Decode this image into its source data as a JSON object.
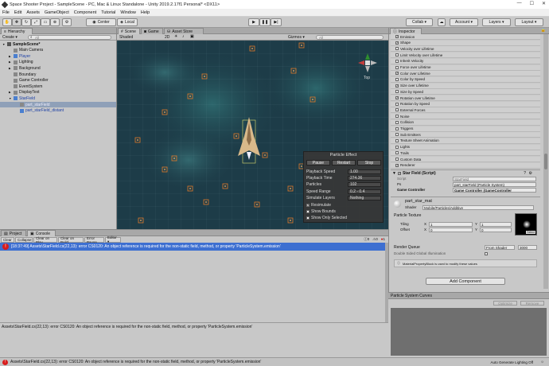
{
  "window": {
    "title": "Space Shooter Project - SampleScene - PC, Mac & Linux Standalone - Unity 2019.2.17f1 Personal* <DX11>",
    "minimize": "—",
    "maximize": "☐",
    "close": "✕"
  },
  "menu": [
    "File",
    "Edit",
    "Assets",
    "GameObject",
    "Component",
    "Tutorial",
    "Window",
    "Help"
  ],
  "toolbar": {
    "pivot_center": "Center",
    "pivot_local": "Local",
    "collab": "Collab ▾",
    "account": "Account ▾",
    "layers": "Layers ▾",
    "layout": "Layout ▾"
  },
  "hierarchy": {
    "tab": "Hierarchy",
    "create": "Create ▾",
    "search_placeholder": "All",
    "items": [
      {
        "label": "SampleScene*",
        "indent": 0,
        "icon": "scene-icon",
        "arrow": "▼",
        "bold": true
      },
      {
        "label": "Main Camera",
        "indent": 1,
        "icon": "cube-icon",
        "arrow": "",
        "bold": false
      },
      {
        "label": "Player",
        "indent": 1,
        "icon": "cube-icon",
        "arrow": "▶",
        "bold": false,
        "blue": true
      },
      {
        "label": "Lighting",
        "indent": 1,
        "icon": "cube-icon",
        "arrow": "▶",
        "bold": false
      },
      {
        "label": "Background",
        "indent": 1,
        "icon": "cube-icon",
        "arrow": "▶",
        "bold": false
      },
      {
        "label": "Boundary",
        "indent": 1,
        "icon": "cube-icon",
        "arrow": "",
        "bold": false
      },
      {
        "label": "Game Controller",
        "indent": 1,
        "icon": "cube-icon",
        "arrow": "",
        "bold": false
      },
      {
        "label": "EventSystem",
        "indent": 1,
        "icon": "cube-icon",
        "arrow": "",
        "bold": false
      },
      {
        "label": "DisplayText",
        "indent": 1,
        "icon": "cube-icon",
        "arrow": "▶",
        "bold": false
      },
      {
        "label": "StarField",
        "indent": 1,
        "icon": "cube-icon",
        "arrow": "▼",
        "bold": false,
        "blue": true
      },
      {
        "label": "part_starField",
        "indent": 2,
        "icon": "cube-icon",
        "arrow": "",
        "bold": false,
        "selected": true
      },
      {
        "label": "part_starField_distant",
        "indent": 2,
        "icon": "cube-icon",
        "arrow": "",
        "bold": false,
        "blue": true
      }
    ]
  },
  "scene": {
    "tab_scene": "Scene",
    "tab_game": "Game",
    "tab_asset_store": "Asset Store",
    "shading": "Shaded",
    "mode_2d": "2D",
    "gizmos": "Gizmos ▾",
    "search_placeholder": "All",
    "persp_label": "Top"
  },
  "particle_effect": {
    "title": "Particle Effect",
    "pause": "Pause",
    "restart": "Restart",
    "stop": "Stop",
    "rows": [
      {
        "label": "Playback Speed",
        "value": "1.00"
      },
      {
        "label": "Playback Time",
        "value": "274.36"
      },
      {
        "label": "Particles",
        "value": "102"
      },
      {
        "label": "Speed Range",
        "value": "0.2 - 0.4"
      },
      {
        "label": "Simulate Layers",
        "value": "Nothing"
      }
    ],
    "resimulate": "Resimulate",
    "show_bounds": "Show Bounds",
    "show_only_selected": "Show Only Selected"
  },
  "inspector": {
    "tab": "Inspector",
    "modules": [
      {
        "label": "Emission",
        "checked": true
      },
      {
        "label": "Shape",
        "checked": true
      },
      {
        "label": "Velocity over Lifetime",
        "checked": false
      },
      {
        "label": "Limit Velocity over Lifetime",
        "checked": false
      },
      {
        "label": "Inherit Velocity",
        "checked": false
      },
      {
        "label": "Force over Lifetime",
        "checked": false
      },
      {
        "label": "Color over Lifetime",
        "checked": true
      },
      {
        "label": "Color by Speed",
        "checked": false
      },
      {
        "label": "Size over Lifetime",
        "checked": true
      },
      {
        "label": "Size by Speed",
        "checked": false
      },
      {
        "label": "Rotation over Lifetime",
        "checked": true
      },
      {
        "label": "Rotation by Speed",
        "checked": false
      },
      {
        "label": "External Forces",
        "checked": false
      },
      {
        "label": "Noise",
        "checked": false
      },
      {
        "label": "Collision",
        "checked": false
      },
      {
        "label": "Triggers",
        "checked": false
      },
      {
        "label": "Sub Emitters",
        "checked": false
      },
      {
        "label": "Texture Sheet Animation",
        "checked": false
      },
      {
        "label": "Lights",
        "checked": false
      },
      {
        "label": "Trails",
        "checked": false
      },
      {
        "label": "Custom Data",
        "checked": false
      },
      {
        "label": "Renderer",
        "checked": true
      }
    ],
    "script_component": {
      "title": "Star Field (Script)",
      "script_label": "Script",
      "script_value": "StarField",
      "ps_label": "Ps",
      "ps_value": "part_starField (Particle System)",
      "gc_label": "Game Controller",
      "gc_value": "Game Controller (GameController"
    },
    "material": {
      "name": "part_star_mat",
      "shader_label": "Shader",
      "shader_value": "Mobile/Particles/Additive",
      "texture_label": "Particle Texture",
      "tiling_label": "Tiling",
      "offset_label": "Offset",
      "x_label": "X",
      "y_label": "Y",
      "tiling_x": "1",
      "tiling_y": "1",
      "offset_x": "0",
      "offset_y": "0",
      "select_label": "Select",
      "render_queue_label": "Render Queue",
      "render_queue_source": "From Shader",
      "render_queue_value": "3000",
      "double_sided_label": "Double Sided Global Illumination",
      "info_text": "MaterialPropertyBlock is used to modify these values"
    },
    "add_component": "Add Component"
  },
  "particle_curves": {
    "title": "Particle System Curves",
    "optimize": "Optimize",
    "remove": "Remove"
  },
  "console": {
    "tab_project": "Project",
    "tab_console": "Console",
    "buttons": [
      "Clear",
      "Collapse",
      "Clear on Play",
      "Clear on Build",
      "Error Pause",
      "Editor ▾"
    ],
    "error_count": "1",
    "warn_count": "0",
    "info_count": "0",
    "log_entry": "[18:37:49] Assets\\StarField.cs(22,13): error CS0120: An object reference is required for the non-static field, method, or property 'ParticleSystem.emission'",
    "detail": "Assets\\StarField.cs(22,13): error CS0120: An object reference is required for the non-static field, method, or property 'ParticleSystem.emission'"
  },
  "status": {
    "message": "Assets\\StarField.cs(22,13): error CS0120: An object reference is required for the non-static field, method, or property 'ParticleSystem.emission'",
    "right": "Auto Generate Lighting Off"
  },
  "colors": {
    "scene_bg": "#1c3a45",
    "selection": "#8fa0b8",
    "error_row": "#3d6fd1",
    "star_orange": "#e07a2a"
  }
}
